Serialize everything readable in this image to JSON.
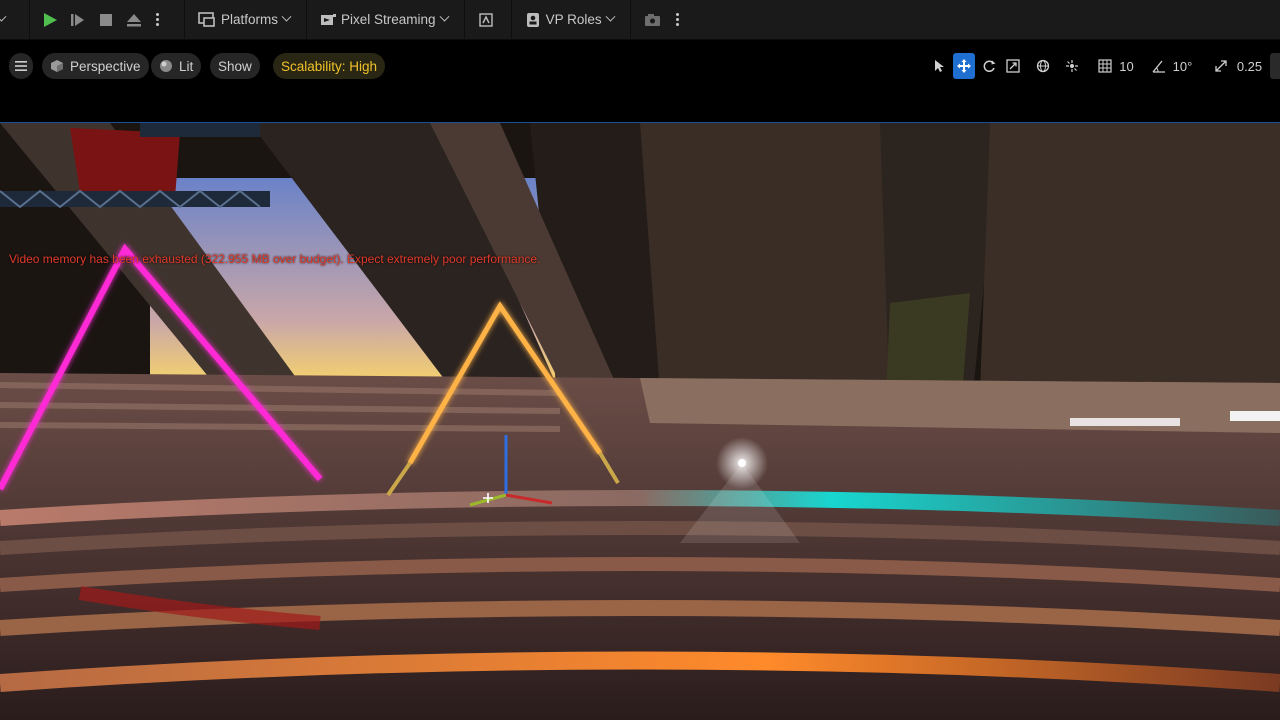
{
  "toolbar": {
    "platforms_label": "Platforms",
    "pixel_streaming_label": "Pixel Streaming",
    "vp_roles_label": "VP Roles"
  },
  "viewport_bar": {
    "perspective_label": "Perspective",
    "lit_label": "Lit",
    "show_label": "Show",
    "scalability_label": "Scalability: High",
    "grid_snap_value": "10",
    "rotation_snap_value": "10°",
    "scale_snap_value": "0.25"
  },
  "viewport": {
    "warning_text": "Video memory has been exhausted (322.955 MB over budget). Expect extremely poor performance."
  },
  "colors": {
    "play_green": "#4fc04f",
    "neon_magenta": "#ff2bd6",
    "neon_orange": "#ffb347",
    "cyan_stripe": "#18d6d0",
    "warning_red": "#e23a2a",
    "scalability_yellow": "#f0c22a",
    "active_blue": "#1f6fd1"
  },
  "icons": {
    "play": "play-icon",
    "skip": "skip-icon",
    "stop": "stop-icon",
    "eject": "eject-icon",
    "platforms": "platforms-icon",
    "pixel_streaming": "pixel-streaming-icon",
    "vp_roles": "vp-roles-icon"
  }
}
